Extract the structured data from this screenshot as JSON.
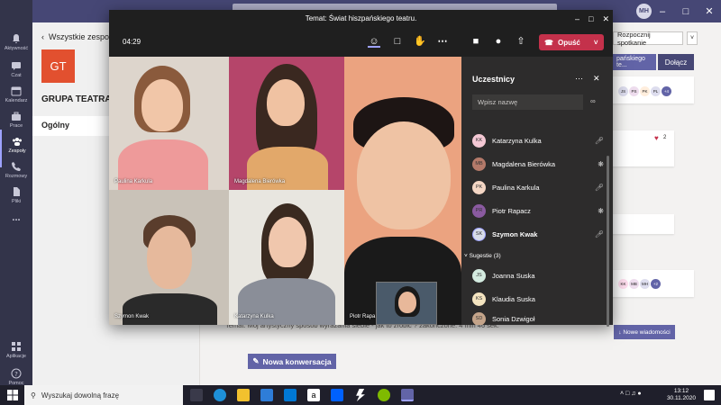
{
  "rail": {
    "items": [
      {
        "label": "Aktywność",
        "icon": "bell-icon"
      },
      {
        "label": "Czat",
        "icon": "chat-icon"
      },
      {
        "label": "Kalendarz",
        "icon": "calendar-icon"
      },
      {
        "label": "Prace",
        "icon": "briefcase-icon"
      },
      {
        "label": "Zespoły",
        "icon": "teams-icon"
      },
      {
        "label": "Rozmowy",
        "icon": "phone-icon"
      },
      {
        "label": "Pliki",
        "icon": "file-icon"
      },
      {
        "label": "...",
        "icon": "more-icon"
      }
    ],
    "bottom": [
      {
        "label": "Aplikacje",
        "icon": "apps-icon"
      },
      {
        "label": "Pomoc",
        "icon": "help-icon"
      }
    ]
  },
  "topbar": {
    "avatar": "MH"
  },
  "leftpane": {
    "back": "Wszystkie zespoły",
    "logo": "GT",
    "team_name": "GRUPA TEATRALI",
    "channel": "Ogólny"
  },
  "main": {
    "start_meeting": "Rozpocznij spotkanie",
    "meeting_chip": "pańskiego te...",
    "join": "Dołącz",
    "reaction_count": "2",
    "more_count_top": "+4",
    "more_count_bottom": "+2",
    "message": "Temat: Mój artystyczny sposób wyrażania siebie - jak to zrobić ? zakończone: 4 min 46 sek.",
    "new_messages": "Nowe wiadomości",
    "new_conversation": "Nowa konwersacja"
  },
  "meeting": {
    "title": "Temat: Świat hiszpańskiego teatru.",
    "timer": "04:29",
    "leave": "Opuść",
    "tiles": [
      {
        "name": "Paulina Karkula"
      },
      {
        "name": "Magdalena Bierówka"
      },
      {
        "name": "Piotr Rapa"
      },
      {
        "name": "Szymon Kwak"
      },
      {
        "name": "Katarzyna Kulka"
      }
    ]
  },
  "panel": {
    "title": "Uczestnicy",
    "search_placeholder": "Wpisz nazwę",
    "participants": [
      {
        "initials": "KK",
        "name": "Katarzyna Kulka",
        "mic": "on"
      },
      {
        "initials": "MB",
        "name": "Magdalena Bierówka",
        "mic": "muted"
      },
      {
        "initials": "PK",
        "name": "Paulina Karkula",
        "mic": "on"
      },
      {
        "initials": "PR",
        "name": "Piotr Rapacz",
        "mic": "muted"
      },
      {
        "initials": "SK",
        "name": "Szymon Kwak",
        "mic": "on"
      }
    ],
    "suggestions_label": "Sugestie (3)",
    "suggestions": [
      {
        "initials": "JS",
        "name": "Joanna Suska"
      },
      {
        "initials": "KS",
        "name": "Klaudia Suska"
      },
      {
        "initials": "SD",
        "name": "Sonia Dzwigoł"
      }
    ]
  },
  "taskbar": {
    "search": "Wyszukaj dowolną frazę",
    "time": "13:12",
    "date": "30.11.2020"
  },
  "colors": {
    "accent": "#6264a7",
    "leave": "#c4314b",
    "rail": "#33344a"
  }
}
